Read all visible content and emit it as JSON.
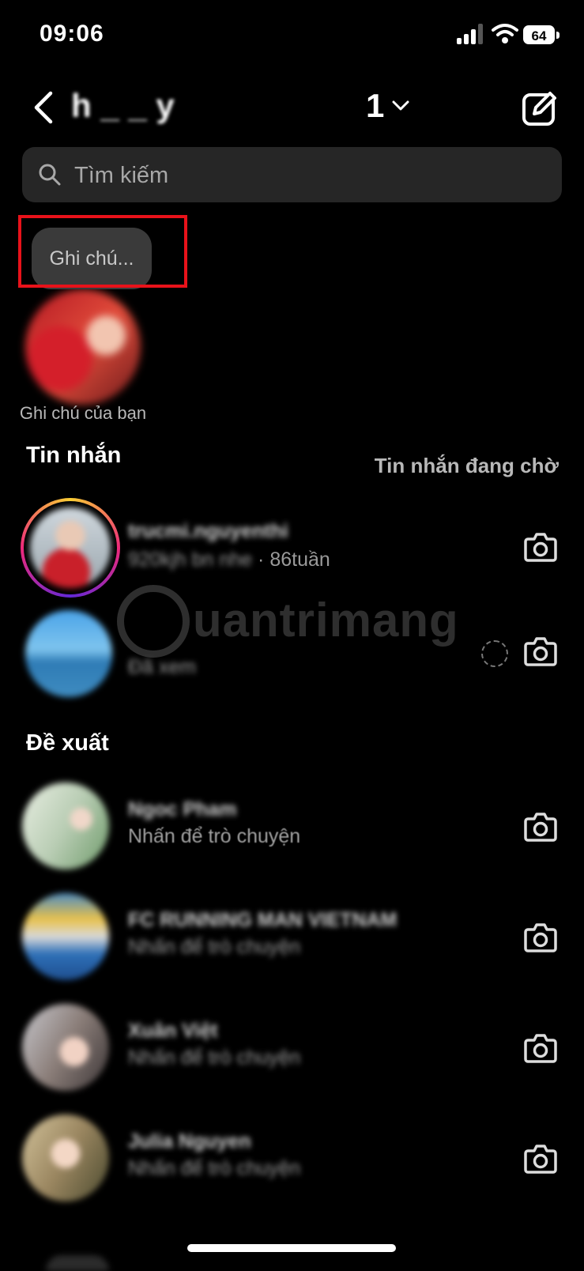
{
  "status_bar": {
    "time": "09:06",
    "battery": "64"
  },
  "header": {
    "account": "h _ _ y",
    "count": "1"
  },
  "search": {
    "placeholder": "Tìm kiếm"
  },
  "note": {
    "bubble": "Ghi chú...",
    "label": "Ghi chú của bạn"
  },
  "messages": {
    "title": "Tin nhắn",
    "pending": "Tin nhắn đang chờ",
    "items": [
      {
        "name": "trucmi.nguyenthi",
        "snippet": "920kjh bn nhe",
        "time": "· 86tuần"
      },
      {
        "name": "",
        "snippet": "Đã xem"
      }
    ]
  },
  "suggest": {
    "title": "Đề xuất",
    "items": [
      {
        "name": "Ngoc Pham",
        "sub": "Nhấn để trò chuyện"
      },
      {
        "name": "FC RUNNING MAN VIETNAM",
        "sub": "Nhấn để trò chuyện"
      },
      {
        "name": "Xuân Việt",
        "sub": "Nhấn để trò chuyện"
      },
      {
        "name": "Julia Nguyen",
        "sub": "Nhấn để trò chuyện"
      }
    ]
  },
  "watermark": "uantrimang",
  "colors": {
    "background": "#000000",
    "highlight": "#e8121a",
    "search_bg": "#262626"
  },
  "icons": [
    "back-icon",
    "chevron-down-icon",
    "compose-icon",
    "search-icon",
    "camera-icon"
  ]
}
